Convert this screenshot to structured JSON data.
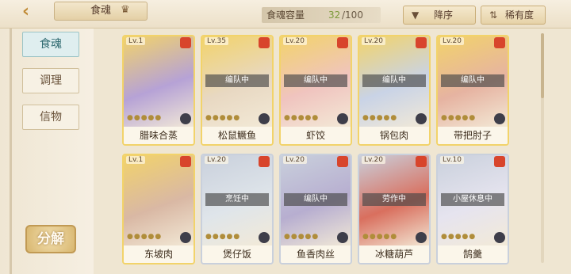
{
  "header": {
    "title": "食魂",
    "capacity_label": "食魂容量",
    "capacity_current": "32",
    "capacity_max": "/100",
    "sort_label": "降序",
    "rarity_label": "稀有度"
  },
  "sidebar": {
    "tabs": [
      {
        "label": "食魂",
        "active": true
      },
      {
        "label": "调理",
        "active": false
      },
      {
        "label": "信物",
        "active": false
      }
    ],
    "decompose_label": "分解"
  },
  "cards": [
    {
      "level": "Lv.1",
      "name": "腊味合蒸",
      "status": "",
      "tint": "#f2d36a",
      "art": "#b6a2d6"
    },
    {
      "level": "Lv.35",
      "name": "松鼠鳜鱼",
      "status": "编队中",
      "tint": "#f2d36a",
      "art": "#e8d8c2"
    },
    {
      "level": "Lv.20",
      "name": "虾饺",
      "status": "编队中",
      "tint": "#f2d36a",
      "art": "#f0c4bf"
    },
    {
      "level": "Lv.20",
      "name": "锅包肉",
      "status": "编队中",
      "tint": "#f2d36a",
      "art": "#c9d3e6"
    },
    {
      "level": "Lv.20",
      "name": "带把肘子",
      "status": "编队中",
      "tint": "#f2d36a",
      "art": "#e6b3a1"
    },
    {
      "level": "Lv.1",
      "name": "东坡肉",
      "status": "",
      "tint": "#f2d36a",
      "art": "#d9b8a4"
    },
    {
      "level": "Lv.20",
      "name": "煲仔饭",
      "status": "烹饪中",
      "tint": "#c9d0dc",
      "art": "#dfe5ea"
    },
    {
      "level": "Lv.20",
      "name": "鱼香肉丝",
      "status": "编队中",
      "tint": "#c9d0dc",
      "art": "#b7aed0"
    },
    {
      "level": "Lv.20",
      "name": "冰糖葫芦",
      "status": "劳作中",
      "tint": "#c9d0dc",
      "art": "#d96f5e"
    },
    {
      "level": "Lv.10",
      "name": "鹄羹",
      "status": "小屋休息中",
      "tint": "#c9d0dc",
      "art": "#e6e4ef"
    }
  ]
}
